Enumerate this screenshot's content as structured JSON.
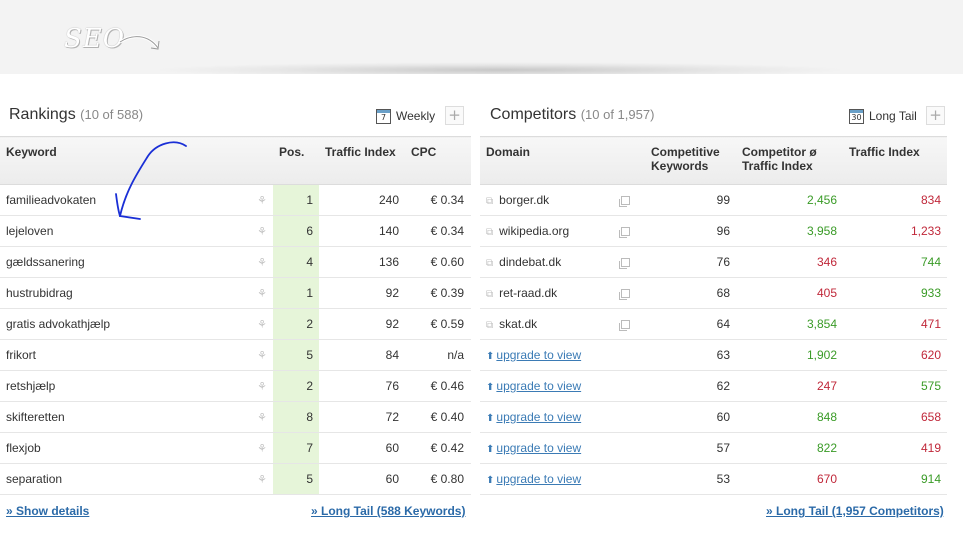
{
  "header": {
    "title": "SEO"
  },
  "rankings": {
    "title": "Rankings",
    "count": "(10 of 588)",
    "toggle_label": "Weekly",
    "toggle_icon_number": "7",
    "columns": [
      "Keyword",
      "Pos.",
      "Traffic Index",
      "CPC"
    ],
    "rows": [
      {
        "keyword": "familieadvokaten",
        "pos": "1",
        "traffic": "240",
        "cpc": "€ 0.34"
      },
      {
        "keyword": "lejeloven",
        "pos": "6",
        "traffic": "140",
        "cpc": "€ 0.34"
      },
      {
        "keyword": "gældssanering",
        "pos": "4",
        "traffic": "136",
        "cpc": "€ 0.60"
      },
      {
        "keyword": "hustrubidrag",
        "pos": "1",
        "traffic": "92",
        "cpc": "€ 0.39"
      },
      {
        "keyword": "gratis advokathjælp",
        "pos": "2",
        "traffic": "92",
        "cpc": "€ 0.59"
      },
      {
        "keyword": "frikort",
        "pos": "5",
        "traffic": "84",
        "cpc": "n/a"
      },
      {
        "keyword": "retshjælp",
        "pos": "2",
        "traffic": "76",
        "cpc": "€ 0.46"
      },
      {
        "keyword": "skifteretten",
        "pos": "8",
        "traffic": "72",
        "cpc": "€ 0.40"
      },
      {
        "keyword": "flexjob",
        "pos": "7",
        "traffic": "60",
        "cpc": "€ 0.42"
      },
      {
        "keyword": "separation",
        "pos": "5",
        "traffic": "60",
        "cpc": "€ 0.80"
      }
    ],
    "show_details": "» Show details",
    "long_tail_link": "» Long Tail (588 Keywords)"
  },
  "competitors": {
    "title": "Competitors",
    "count": "(10 of 1,957)",
    "toggle_label": "Long Tail",
    "toggle_icon_number": "30",
    "columns": [
      "Domain",
      "Competitive Keywords",
      "Competitor ø Traffic Index",
      "Traffic Index"
    ],
    "rows": [
      {
        "domain": "borger.dk",
        "upgrade": false,
        "keywords": "99",
        "comp_traffic": "2,456",
        "comp_color": "green",
        "traffic": "834",
        "traffic_color": "red"
      },
      {
        "domain": "wikipedia.org",
        "upgrade": false,
        "keywords": "96",
        "comp_traffic": "3,958",
        "comp_color": "green",
        "traffic": "1,233",
        "traffic_color": "red"
      },
      {
        "domain": "dindebat.dk",
        "upgrade": false,
        "keywords": "76",
        "comp_traffic": "346",
        "comp_color": "red",
        "traffic": "744",
        "traffic_color": "green"
      },
      {
        "domain": "ret-raad.dk",
        "upgrade": false,
        "keywords": "68",
        "comp_traffic": "405",
        "comp_color": "red",
        "traffic": "933",
        "traffic_color": "green"
      },
      {
        "domain": "skat.dk",
        "upgrade": false,
        "keywords": "64",
        "comp_traffic": "3,854",
        "comp_color": "green",
        "traffic": "471",
        "traffic_color": "red"
      },
      {
        "domain": "upgrade to view",
        "upgrade": true,
        "keywords": "63",
        "comp_traffic": "1,902",
        "comp_color": "green",
        "traffic": "620",
        "traffic_color": "red"
      },
      {
        "domain": "upgrade to view",
        "upgrade": true,
        "keywords": "62",
        "comp_traffic": "247",
        "comp_color": "red",
        "traffic": "575",
        "traffic_color": "green"
      },
      {
        "domain": "upgrade to view",
        "upgrade": true,
        "keywords": "60",
        "comp_traffic": "848",
        "comp_color": "green",
        "traffic": "658",
        "traffic_color": "red"
      },
      {
        "domain": "upgrade to view",
        "upgrade": true,
        "keywords": "57",
        "comp_traffic": "822",
        "comp_color": "green",
        "traffic": "419",
        "traffic_color": "red"
      },
      {
        "domain": "upgrade to view",
        "upgrade": true,
        "keywords": "53",
        "comp_traffic": "670",
        "comp_color": "red",
        "traffic": "914",
        "traffic_color": "green"
      }
    ],
    "long_tail_link": "» Long Tail (1,957 Competitors)"
  },
  "colors": {
    "green": "#3a9b27",
    "red": "#c0283a",
    "link": "#2b6aa8",
    "pos_highlight": "#e6f5d9",
    "annotation": "#1a2fd6"
  }
}
